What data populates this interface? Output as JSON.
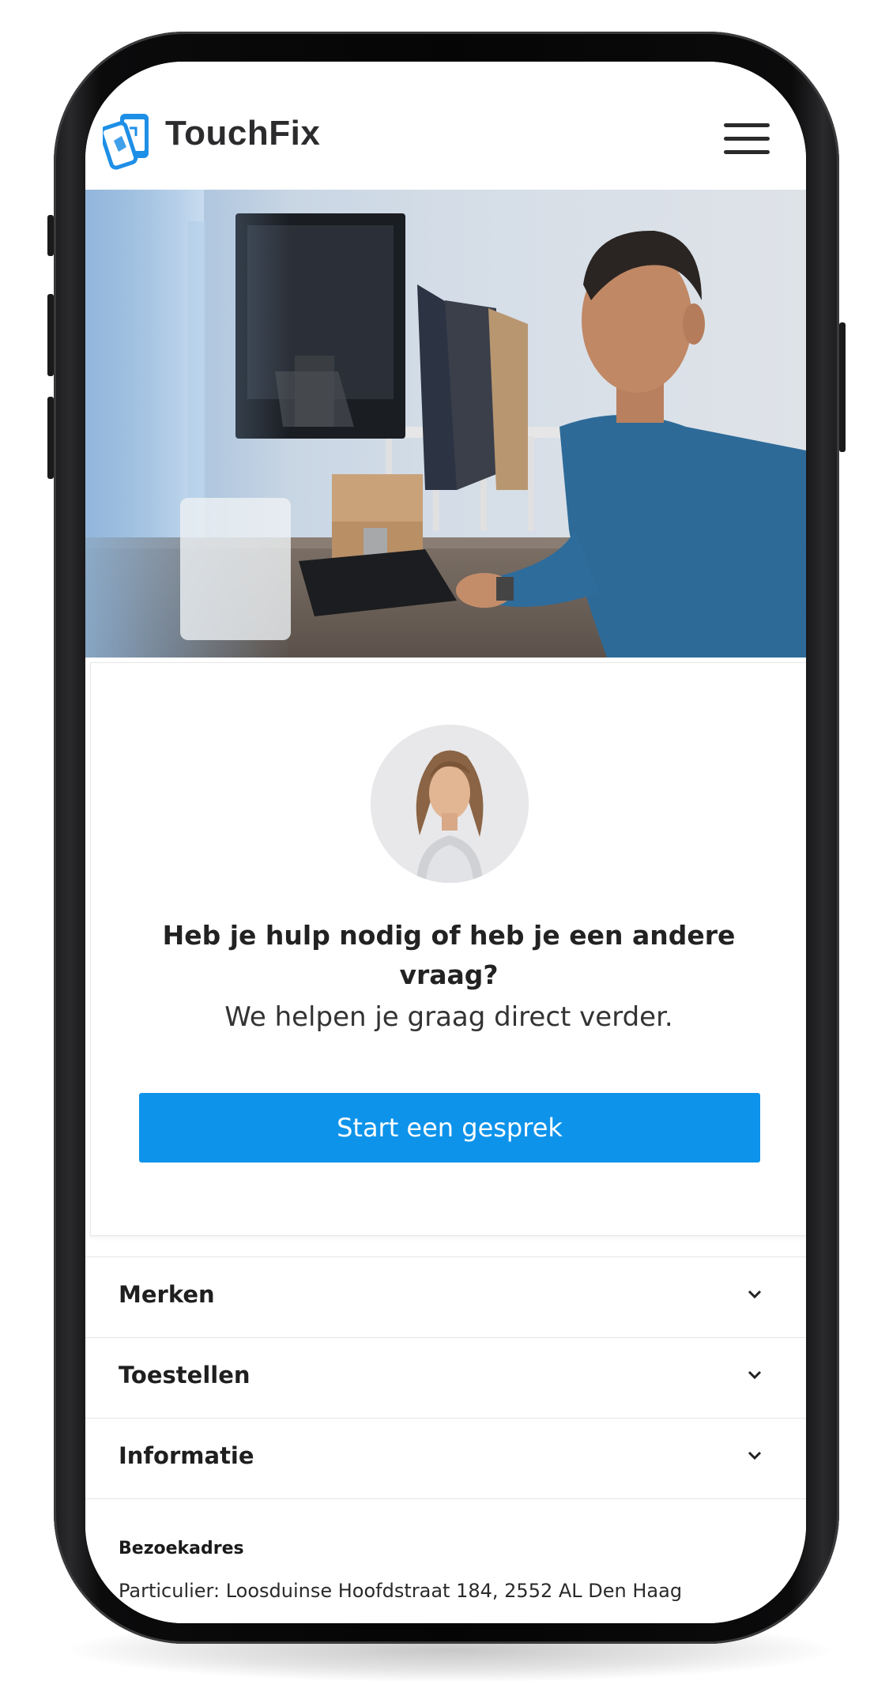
{
  "header": {
    "brand": "TouchFix"
  },
  "help_card": {
    "title": "Heb je hulp nodig of heb je een andere vraag?",
    "subtitle": "We helpen je graag direct verder.",
    "cta_label": "Start een gesprek"
  },
  "accordion": [
    {
      "label": "Merken"
    },
    {
      "label": "Toestellen"
    },
    {
      "label": "Informatie"
    }
  ],
  "footer": {
    "heading": "Bezoekadres",
    "address": "Particulier: Loosduinse Hoofdstraat 184, 2552 AL Den Haag"
  },
  "colors": {
    "accent": "#0e93ea",
    "logo_blue": "#1e8fe6",
    "text": "#222222"
  },
  "icons": {
    "logo": "touchfix-logo-icon",
    "menu": "hamburger-menu-icon",
    "expand": "chevron-down-icon"
  }
}
